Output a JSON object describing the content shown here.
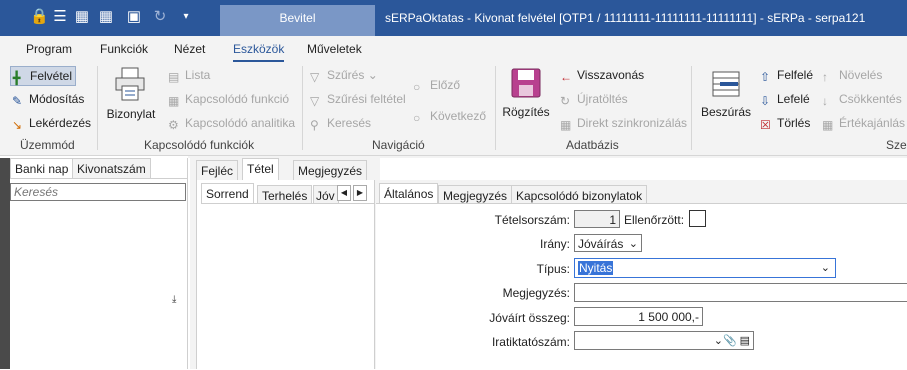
{
  "titlebar": {
    "context_tab": "Bevitel",
    "window_title": "sERPaOktatas - Kivonat felvétel [OTP1 / 11111111-11111111-11111111] - sERPa - serpa121"
  },
  "menu": [
    "Program",
    "Funkciók",
    "Nézet",
    "Eszközök",
    "Műveletek"
  ],
  "ribbon": {
    "mode": {
      "new": "Felvétel",
      "modify": "Módosítás",
      "query": "Lekérdezés",
      "group": "Üzemmód"
    },
    "related": {
      "document": "Bizonylat",
      "list": "Lista",
      "related_function": "Kapcsolódó funkció",
      "related_analytics": "Kapcsolódó analitika",
      "group": "Kapcsolódó funkciók"
    },
    "nav": {
      "filter": "Szűrés",
      "filter_condition": "Szűrési feltétel",
      "search": "Keresés",
      "previous": "Előző",
      "next": "Következő",
      "group": "Navigáció"
    },
    "db": {
      "save": "Rögzítés",
      "undo": "Visszavonás",
      "reload": "Újratöltés",
      "direct_sync": "Direkt szinkronizálás",
      "group": "Adatbázis"
    },
    "edit": {
      "insert": "Beszúrás",
      "up": "Felfelé",
      "down": "Lefelé",
      "delete": "Törlés",
      "increase": "Növelés",
      "decrease": "Csökkentés",
      "valuelist": "Értékajánlás",
      "group": "Szer"
    }
  },
  "left_tabs": [
    "Banki nap",
    "Kivonatszám"
  ],
  "search_placeholder": "Keresés",
  "mid_tabs": [
    "Fejléc",
    "Tétel",
    "Megjegyzés"
  ],
  "sub_tabs": [
    "Sorrend",
    "Terhelés",
    "Jóv"
  ],
  "detail_tabs": [
    "Általános",
    "Megjegyzés",
    "Kapcsolódó bizonylatok"
  ],
  "form": {
    "item_no_label": "Tételsorszám:",
    "item_no": "1",
    "checked_label": "Ellenőrzött:",
    "direction_label": "Irány:",
    "direction": "Jóváírás",
    "type_label": "Típus:",
    "type": "Nyitás",
    "note_label": "Megjegyzés:",
    "note": "",
    "amount_label": "Jóváírt összeg:",
    "amount": "1 500 000,-",
    "file_label": "Iratiktatószám:",
    "file": ""
  },
  "colors": {
    "accent": "#2b579a",
    "ribbon_bg": "#f3f3f3",
    "selection": "#3874d8"
  }
}
